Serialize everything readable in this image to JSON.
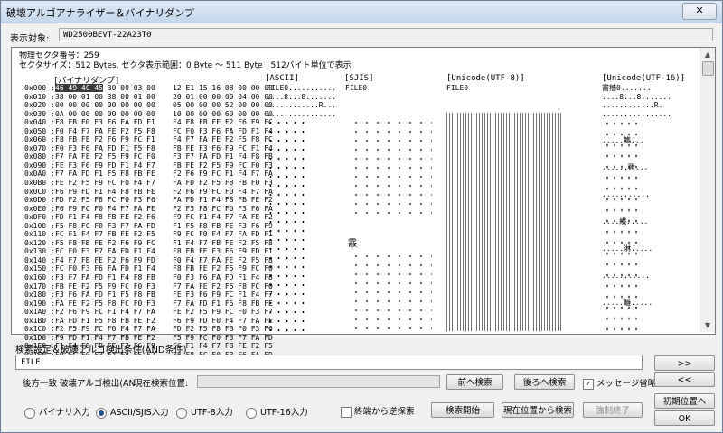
{
  "window": {
    "title": "破壊アルゴアナライザー＆バイナリダンプ",
    "close": "✕"
  },
  "target": {
    "label": "表示対象:",
    "value": "WD2500BEVT-22A23T0"
  },
  "info": {
    "sector_line": "物理セクタ番号：259",
    "size_line": "セクタサイズ：512 Bytes, セクタ表示範囲：0 Byte 〜 511 Byte　512バイト単位で表示"
  },
  "columns": {
    "binary": "[バイナリダンプ]",
    "ascii": "[ASCII]",
    "sjis": "[SJIS]",
    "utf8": "[Unicode(UTF-8)]",
    "utf16": "[Unicode(UTF-16)]"
  },
  "dump": {
    "offsets": "0x000 :\n0x010 :\n0x020 :\n0x030 :\n0x040 :\n0x050 :\n0x060 :\n0x070 :\n0x080 :\n0x090 :\n0x0A0 :\n0x0B0 :\n0x0C0 :\n0x0D0 :\n0x0E0 :\n0x0F0 :\n0x100 :\n0x110 :\n0x120 :\n0x130 :\n0x140 :\n0x150 :\n0x160 :\n0x170 :\n0x180 :\n0x190 :\n0x1A0 :\n0x1B0 :\n0x1C0 :\n0x1D0 :\n0x1E0 :\n0x1F0 :",
    "hex_selected": "46 49 4C 45",
    "hex_rest": " 30 00 03 00    12 E1 15 16 08 00 00 00\n38 00 01 00 38 00 01 00    20 01 00 00 00 04 00 00\n00 00 00 00 00 00 00 00    05 00 00 00 52 00 00 00\n0A 00 00 00 00 00 00 00    10 00 00 00 60 00 00 00\nF8 FB F0 F3 F6 FA FD F1    F4 F8 FB FE F2 F6 F9 FC\nF0 F4 F7 FA FE F2 F5 F8    FC F0 F3 F6 FA FD F1 F4\nF8 FB FE F2 F6 F9 FC F1    F4 F7 FA FE F2 F5 F8 FC\nF0 F3 F6 FA FD F1 F5 F8    FB FE F3 F6 F9 FC F1 F4\nF7 FA FE F2 F5 F9 FC F0    F3 F7 FA FD F1 F4 F8 FB\nFE F3 F6 F9 FD F1 F4 F7    FB FE F2 F5 F9 FC F0 F3\nF7 FA FD F1 F5 F8 FB FE    F2 F6 F9 FC F1 F4 F7 FA\nFE F2 F5 F9 FC F0 F4 F7    FA FD F2 F5 F8 FB F0 F3\nF6 F9 FD F1 F4 F8 FB FE    F2 F6 F9 FC F0 F4 F7 FA\nFD F2 F5 F8 FC F0 F3 F6    FA FD F1 F4 F8 FB FE F2\nF6 F9 FC F0 F4 F7 FA FE    F2 F5 F8 FC F0 F3 F6 FA\nFD F1 F4 F8 FB FE F2 F6    F9 FC F1 F4 F7 FA FE F2\nF5 F8 FC F0 F3 F7 FA FD    F1 F5 F8 FB FE F3 F6 F9\nFC F1 F4 F7 FB FE F2 F5    F9 FC F0 F4 F7 FA FD F1\nF5 F8 FB FE F2 F6 F9 FC    F1 F4 F7 FB FE F2 F5 F8\nFC F0 F3 F7 FA FD F1 F4    F8 FB FE F3 F6 F9 FD F1\nF4 F7 FB FE F2 F6 F9 FD    F0 F4 F7 FA FE F2 F5 F8\nFC F0 F3 F6 FA FD F1 F4    F8 FB FE F2 F5 F9 FC F0\nF3 F7 FA FD F1 F4 F8 FB    F0 F3 F6 FA FD F1 F4 F8\nFB FE F2 F5 F9 FC F0 F3    F7 FA FE F2 F5 F8 FC F0\nF3 F6 FA FD F1 F5 F8 FB    FE F3 F6 F9 FC F1 F4 F7\nFA FE F2 F5 F8 FC F0 F3    F7 FA FD F1 F5 F8 FB FE\nF2 F6 F9 FC F1 F4 F7 FA    FE F2 F5 F9 FC F0 F3 F7\nFA FD F1 F5 F8 FB FE F2    F6 F9 FD F0 F4 F7 FA FE\nF2 F5 F9 FC F0 F4 F7 FA    FD F2 F5 F8 FB F0 F3 F6\nF9 FD F1 F4 F7 FB FE F2    F5 F9 FC F0 F3 F7 FA FD\nF1 F4 F8 FB FE F2 F6 F9    FC F1 F4 F7 FB FE F2 F5\nF9 FC F0 F3 F7 FA FE F2    F5 F8 FC F0 F3 F6 FA FD",
    "ascii_head": "FILE0...........\n....8...8.......\n............R...\n................",
    "sjis_head": "FILE0",
    "sjis_char": "霰",
    "utf8_head": "FILE0",
    "utf16_head": "畵穡0.......\n....8...8.......\n............R.\n................",
    "utf16_tail_marks": ".....觹...\n......雞...\n...........\n....繊.....\n.....淋.....\n...........\n.....籬....."
  },
  "search": {
    "label": "検索設定＆破壊アルゴ検出条件(AND条件)",
    "value": "FILE",
    "mode_text": "後方一致 破壊アルゴ検出(AN",
    "position_label": "現在検索位置:",
    "progress": 0.0
  },
  "buttons": {
    "next": ">>",
    "prev": "<<",
    "search_fwd": "前へ検索",
    "search_back": "後ろへ検索",
    "msg_omit": "メッセージ省略",
    "init_pos": "初期位置へ",
    "reverse": "終端から逆探索",
    "start": "検索開始",
    "from_current": "現在位置から検索",
    "force_stop": "強制終了",
    "ok": "OK"
  },
  "inputs": {
    "binary": "バイナリ入力",
    "ascii_sjis": "ASCII/SJIS入力",
    "utf8": "UTF-8入力",
    "utf16": "UTF-16入力"
  },
  "state": {
    "msg_omit_checked": true,
    "reverse_checked": false,
    "selected_input": "ascii_sjis"
  }
}
